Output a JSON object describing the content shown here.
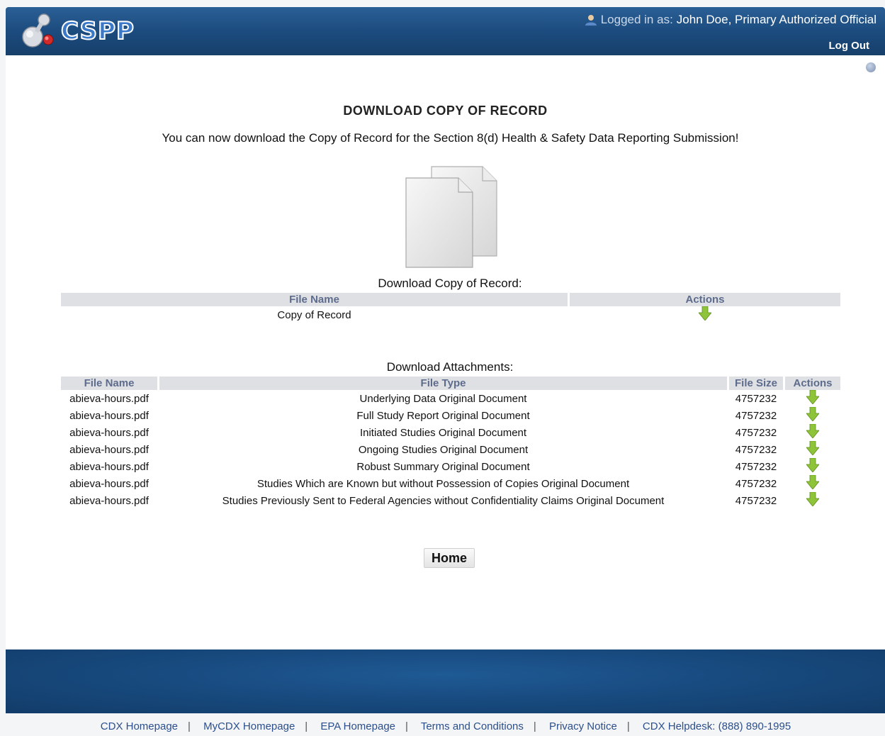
{
  "header": {
    "logo_text": "CSPP",
    "logged_in_prefix": "Logged in as:",
    "logged_in_user": "John Doe, Primary Authorized Official",
    "logout_label": "Log Out"
  },
  "page": {
    "title": "DOWNLOAD COPY OF RECORD",
    "subtitle": "You can now download the Copy of Record for the Section 8(d) Health & Safety Data Reporting Submission!"
  },
  "copy_of_record": {
    "label": "Download Copy of Record:",
    "columns": [
      "File Name",
      "Actions"
    ],
    "rows": [
      {
        "file_name": "Copy of Record"
      }
    ]
  },
  "attachments": {
    "label": "Download Attachments:",
    "columns": [
      "File Name",
      "File Type",
      "File Size",
      "Actions"
    ],
    "rows": [
      {
        "file_name": "abieva-hours.pdf",
        "file_type": "Underlying Data Original Document",
        "file_size": "4757232"
      },
      {
        "file_name": "abieva-hours.pdf",
        "file_type": "Full Study Report Original Document",
        "file_size": "4757232"
      },
      {
        "file_name": "abieva-hours.pdf",
        "file_type": "Initiated Studies Original Document",
        "file_size": "4757232"
      },
      {
        "file_name": "abieva-hours.pdf",
        "file_type": "Ongoing Studies Original Document",
        "file_size": "4757232"
      },
      {
        "file_name": "abieva-hours.pdf",
        "file_type": "Robust Summary Original Document",
        "file_size": "4757232"
      },
      {
        "file_name": "abieva-hours.pdf",
        "file_type": "Studies Which are Known but without Possession of Copies Original Document",
        "file_size": "4757232"
      },
      {
        "file_name": "abieva-hours.pdf",
        "file_type": "Studies Previously Sent to Federal Agencies without Confidentiality Claims Original Document",
        "file_size": "4757232"
      }
    ]
  },
  "home_button": "Home",
  "footer": {
    "links": [
      "CDX Homepage",
      "MyCDX Homepage",
      "EPA Homepage",
      "Terms and Conditions",
      "Privacy Notice",
      "CDX Helpdesk: (888) 890-1995"
    ]
  },
  "icons": {
    "download": "download-arrow-icon",
    "user": "user-icon",
    "help": "help-icon",
    "document": "document-copy-icon"
  },
  "colors": {
    "header_blue": "#1b4a7c",
    "download_green": "#8fc43a",
    "table_header_text": "#5d6c8c",
    "link_blue": "#2c4f8c"
  }
}
